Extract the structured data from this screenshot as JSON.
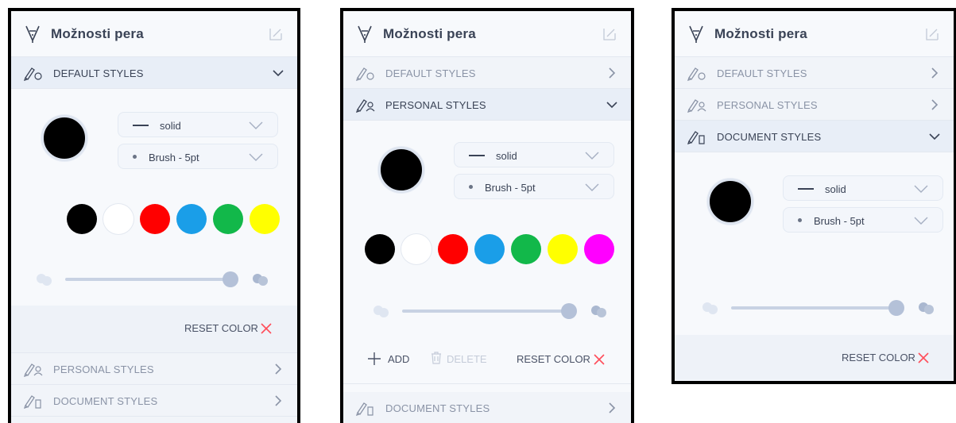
{
  "title": "Možnosti pera",
  "sections": {
    "default": "DEFAULT STYLES",
    "personal": "PERSONAL STYLES",
    "document": "DOCUMENT STYLES"
  },
  "line_style": "solid",
  "brush_size": "Brush - 5pt",
  "reset_color": "RESET COLOR",
  "add": "ADD",
  "delete": "DELETE",
  "colors": {
    "selected": "#000000",
    "palette_default": [
      "#000000",
      "#ffffff",
      "#ff0000",
      "#1a9ee8",
      "#12b84a",
      "#ffff00"
    ],
    "palette_personal": [
      "#000000",
      "#ffffff",
      "#ff0000",
      "#1a9ee8",
      "#12b84a",
      "#ffff00",
      "#ff00ff"
    ],
    "accent_x": "#ff4d5a"
  },
  "opacity_slider": 0.9
}
